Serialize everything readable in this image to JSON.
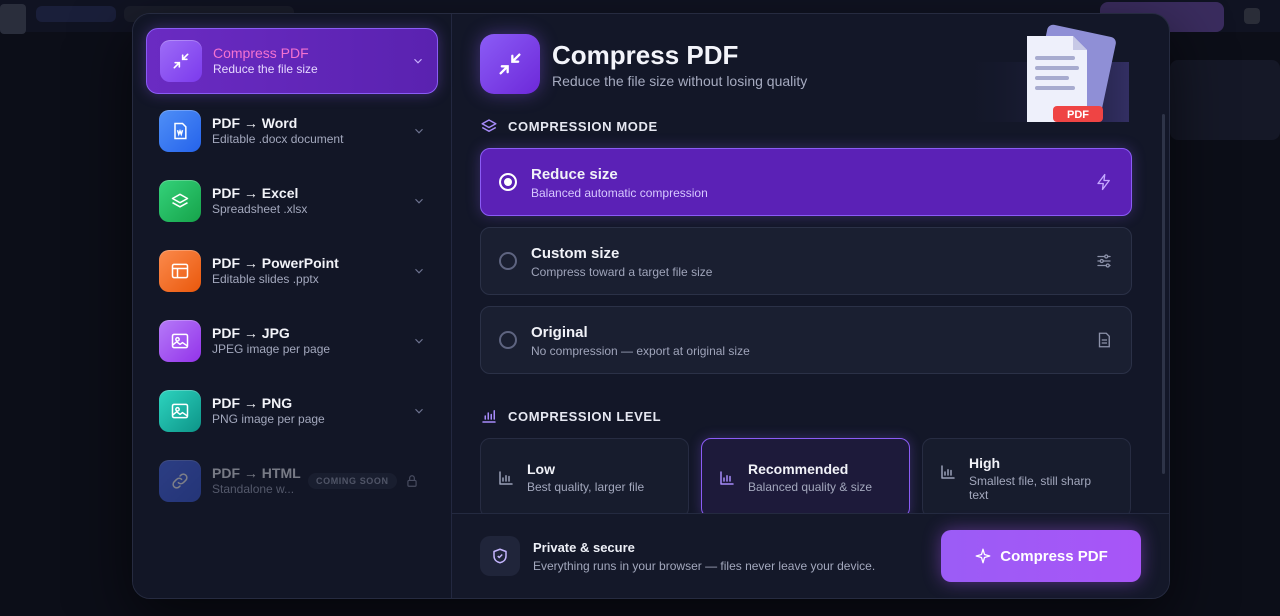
{
  "sidebar": {
    "items": [
      {
        "name": "Compress PDF",
        "desc": "Reduce the file size",
        "icon": "compress-icon",
        "color": "#8b5cf6"
      },
      {
        "name": "PDF → Word",
        "desc": "Editable .docx document",
        "icon": "word-doc-icon",
        "color": "#3b82f6"
      },
      {
        "name": "PDF → Excel",
        "desc": "Spreadsheet .xlsx",
        "icon": "layers-icon",
        "color": "#22c55e"
      },
      {
        "name": "PDF → PowerPoint",
        "desc": "Editable slides .pptx",
        "icon": "slides-icon",
        "color": "#f97316"
      },
      {
        "name": "PDF → JPG",
        "desc": "JPEG image per page",
        "icon": "image-icon",
        "color": "#a855f7"
      },
      {
        "name": "PDF → PNG",
        "desc": "PNG image per page",
        "icon": "image-icon",
        "color": "#14b8a6"
      },
      {
        "name": "PDF → HTML",
        "desc": "Standalone w...",
        "icon": "link-icon",
        "color": "#3b5bdb",
        "badge": "COMING SOON"
      }
    ]
  },
  "header": {
    "title": "Compress PDF",
    "subtitle": "Reduce the file size without losing quality",
    "illustration_badge": "PDF"
  },
  "compression_mode": {
    "label": "COMPRESSION MODE",
    "options": [
      {
        "title": "Reduce size",
        "desc": "Balanced automatic compression",
        "icon": "bolt-icon",
        "selected": true
      },
      {
        "title": "Custom size",
        "desc": "Compress toward a target file size",
        "icon": "sliders-icon",
        "selected": false
      },
      {
        "title": "Original",
        "desc": "No compression — export at original size",
        "icon": "file-icon",
        "selected": false
      }
    ]
  },
  "compression_level": {
    "label": "COMPRESSION LEVEL",
    "options": [
      {
        "title": "Low",
        "desc": "Best quality, larger file",
        "selected": false
      },
      {
        "title": "Recommended",
        "desc": "Balanced quality & size",
        "selected": true
      },
      {
        "title": "High",
        "desc": "Smallest file, still sharp text",
        "selected": false
      }
    ]
  },
  "footer": {
    "title": "Private & secure",
    "desc": "Everything runs in your browser — files never leave your device.",
    "cta": "Compress PDF"
  },
  "colors": {
    "accent": "#8b5cf6",
    "background": "#131728"
  }
}
